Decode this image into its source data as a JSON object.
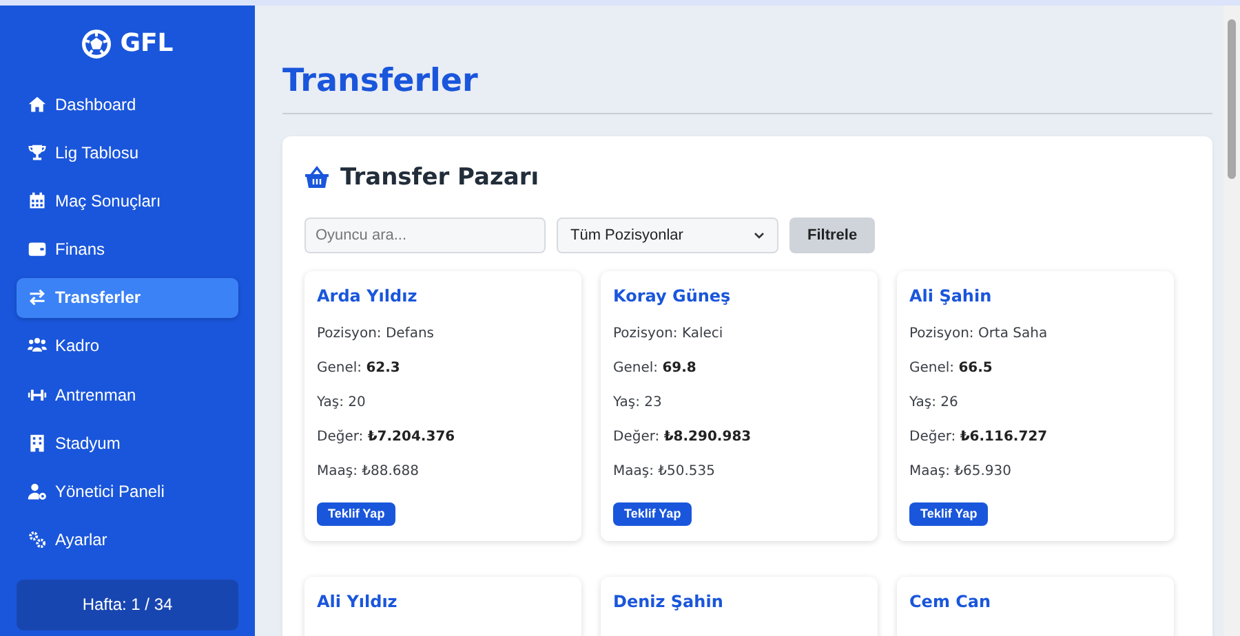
{
  "sidebar": {
    "logo": "GFL",
    "items": [
      {
        "label": "Dashboard",
        "selected": false
      },
      {
        "label": "Lig Tablosu",
        "selected": false
      },
      {
        "label": "Maç Sonuçları",
        "selected": false
      },
      {
        "label": "Finans",
        "selected": false
      },
      {
        "label": "Transferler",
        "selected": true
      },
      {
        "label": "Kadro",
        "selected": false
      },
      {
        "label": "Antrenman",
        "selected": false
      },
      {
        "label": "Stadyum",
        "selected": false
      },
      {
        "label": "Yönetici Paneli",
        "selected": false
      },
      {
        "label": "Ayarlar",
        "selected": false
      }
    ],
    "week": "Hafta: 1 / 34"
  },
  "page_title": "Transferler",
  "market": {
    "title": "Transfer Pazarı",
    "search": {
      "placeholder": "Oyuncu ara..."
    },
    "position_select": "Tüm Pozisyonlar",
    "filter_button": "Filtrele",
    "players": [
      {
        "name": "Arda Yıldız",
        "lines": [
          "Pozisyon: Defans",
          "Genel: **62.3**",
          "Yaş: 20",
          "Değer: **₺7.204.376**",
          "Maaş: ₺88.688"
        ],
        "button": "Teklif Yap"
      },
      {
        "name": "Koray Güneş",
        "lines": [
          "Pozisyon: Kaleci",
          "Genel: **69.8**",
          "Yaş: 23",
          "Değer: **₺8.290.983**",
          "Maaş: ₺50.535"
        ],
        "button": "Teklif Yap"
      },
      {
        "name": "Ali Şahin",
        "lines": [
          "Pozisyon: Orta Saha",
          "Genel: **66.5**",
          "Yaş: 26",
          "Değer: **₺6.116.727**",
          "Maaş: ₺65.930"
        ],
        "button": "Teklif Yap"
      },
      {
        "name": "Ali Yıldız"
      },
      {
        "name": "Deniz Şahin"
      },
      {
        "name": "Cem Can"
      }
    ]
  }
}
